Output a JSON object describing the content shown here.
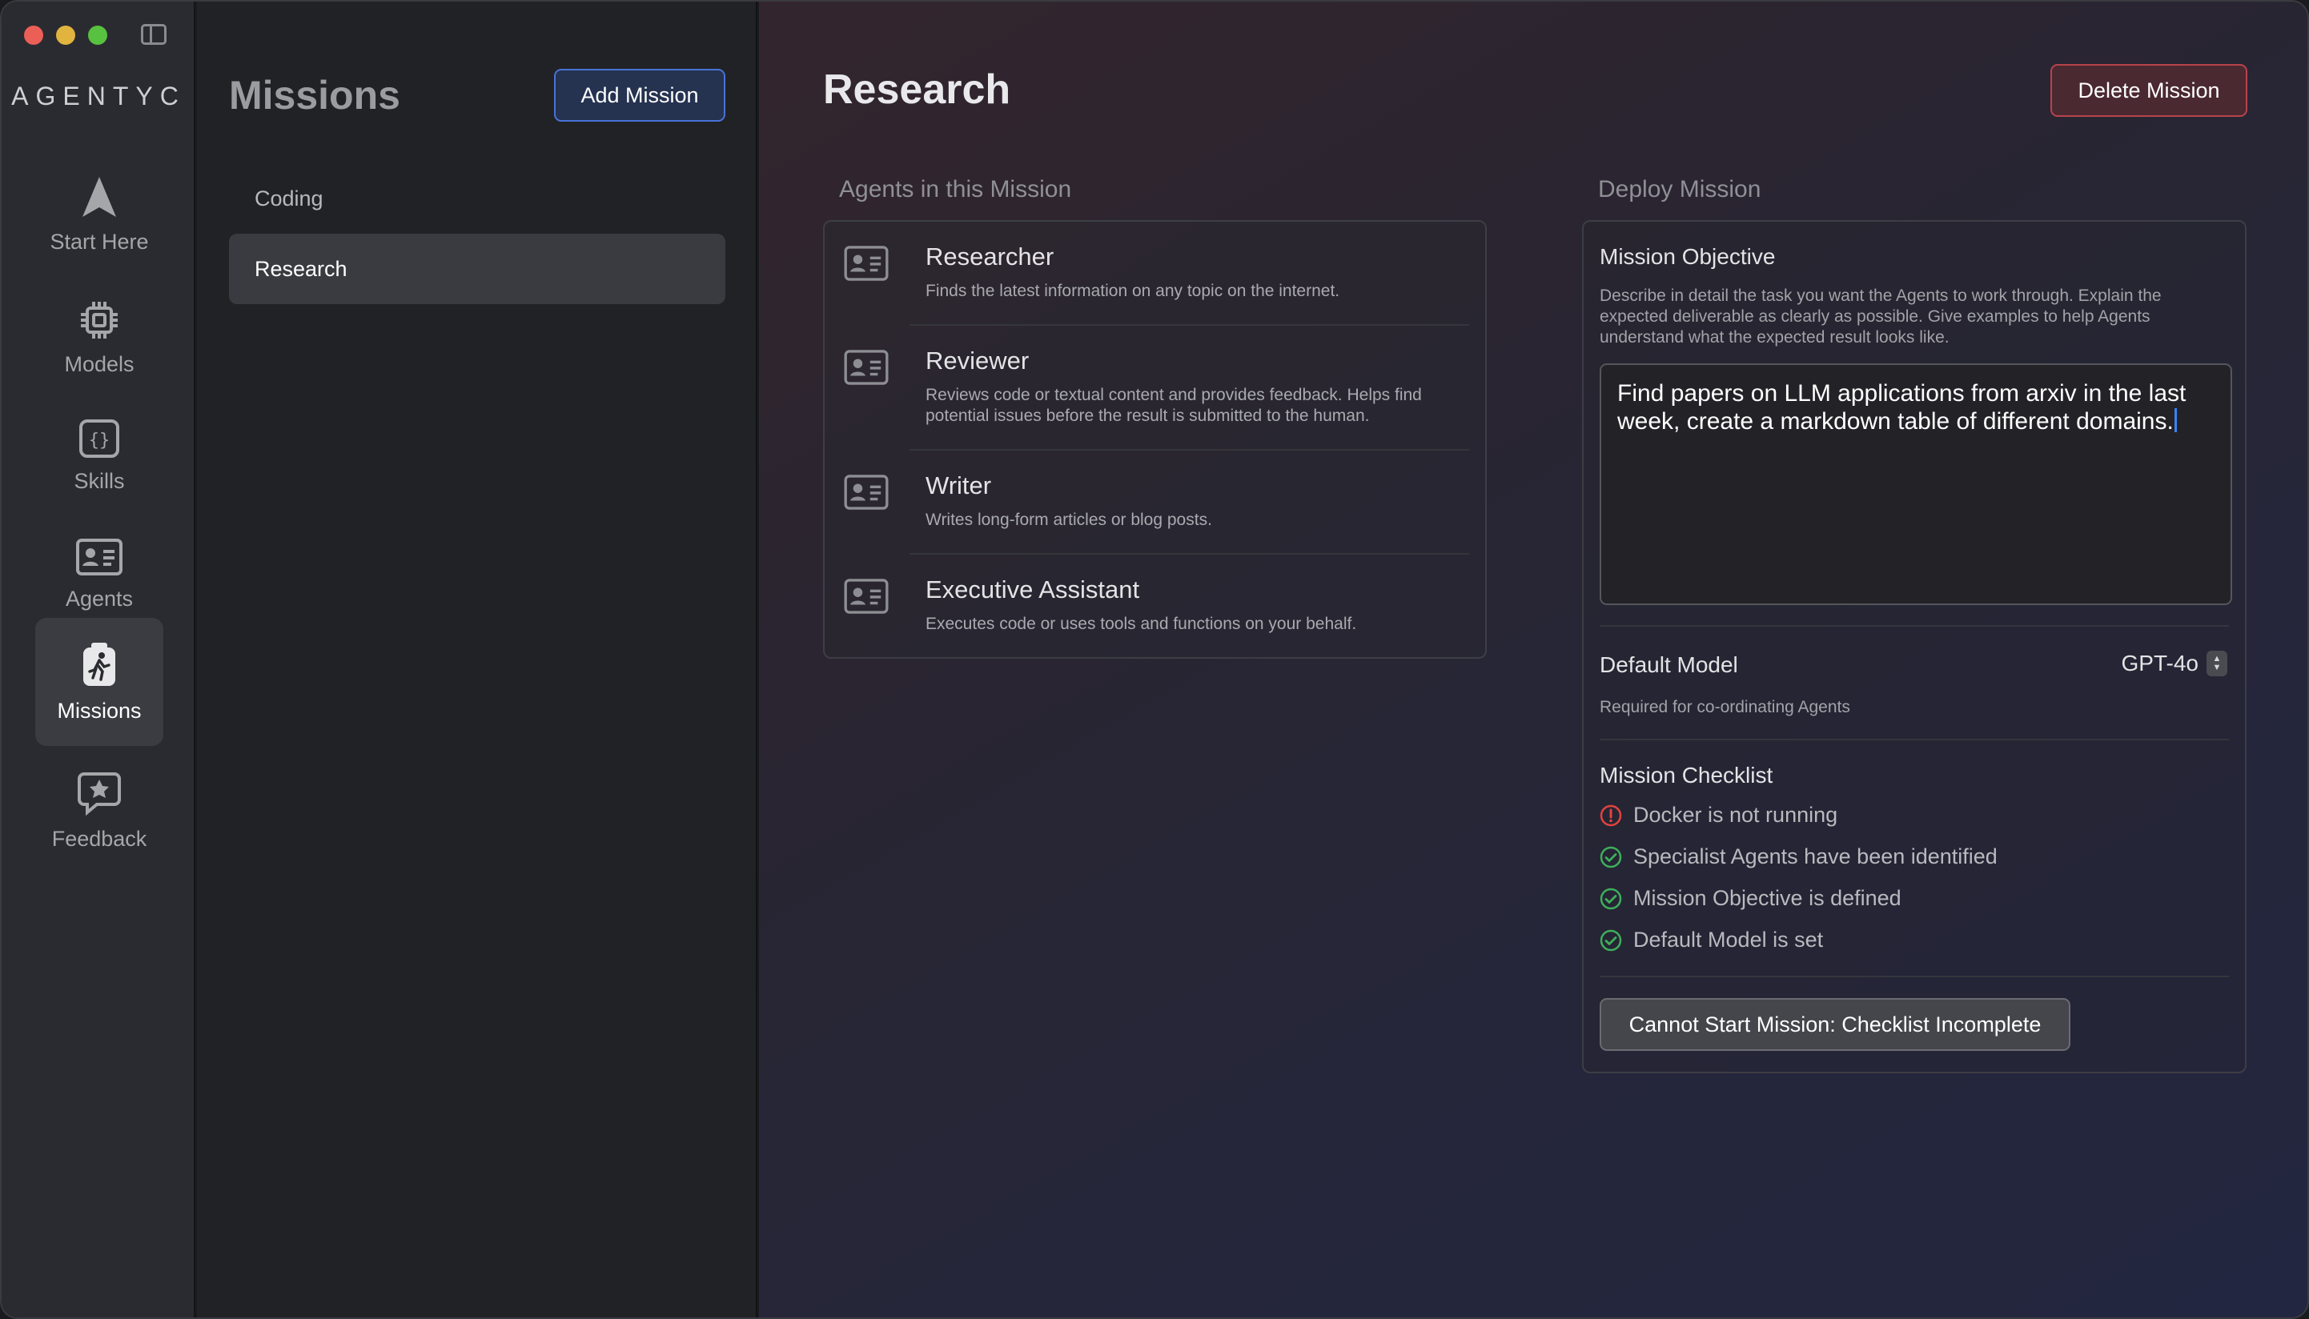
{
  "app": {
    "logo": "AGENTYC"
  },
  "nav": {
    "items": [
      {
        "label": "Start Here",
        "icon": "navigation-arrow-icon"
      },
      {
        "label": "Models",
        "icon": "chip-icon"
      },
      {
        "label": "Skills",
        "icon": "braces-icon"
      },
      {
        "label": "Agents",
        "icon": "id-card-icon"
      },
      {
        "label": "Missions",
        "icon": "runner-icon",
        "active": true
      },
      {
        "label": "Feedback",
        "icon": "star-bubble-icon"
      }
    ]
  },
  "missions": {
    "title": "Missions",
    "add_label": "Add Mission",
    "items": [
      {
        "label": "Coding"
      },
      {
        "label": "Research",
        "selected": true
      }
    ]
  },
  "detail": {
    "title": "Research",
    "delete_label": "Delete Mission",
    "agents_section_title": "Agents in this Mission",
    "agents": [
      {
        "name": "Researcher",
        "desc": "Finds the latest information on any topic on the internet."
      },
      {
        "name": "Reviewer",
        "desc": "Reviews code or textual content and provides feedback. Helps find potential issues before the result is submitted to the human."
      },
      {
        "name": "Writer",
        "desc": "Writes long-form articles or blog posts."
      },
      {
        "name": "Executive Assistant",
        "desc": "Executes code or uses tools and functions on your behalf."
      }
    ],
    "deploy": {
      "section_title": "Deploy Mission",
      "objective_label": "Mission Objective",
      "objective_help": "Describe in detail the task you want the Agents to work through. Explain the expected deliverable as clearly as possible. Give examples to help Agents understand what the expected result looks like.",
      "objective_value": "Find papers on LLM applications from arxiv in the last week, create a markdown table of different domains.",
      "default_model_label": "Default Model",
      "default_model_value": "GPT-4o",
      "default_model_help": "Required for co-ordinating Agents",
      "checklist_title": "Mission Checklist",
      "checklist": [
        {
          "label": "Docker is not running",
          "status": "error"
        },
        {
          "label": "Specialist Agents have been identified",
          "status": "ok"
        },
        {
          "label": "Mission Objective is defined",
          "status": "ok"
        },
        {
          "label": "Default Model is set",
          "status": "ok"
        }
      ],
      "start_label": "Cannot Start Mission: Checklist Incomplete"
    }
  },
  "colors": {
    "accent_blue": "#4a72d6",
    "danger_red": "#b8434c",
    "ok_green": "#3fae5a",
    "error_red": "#e0443e"
  }
}
